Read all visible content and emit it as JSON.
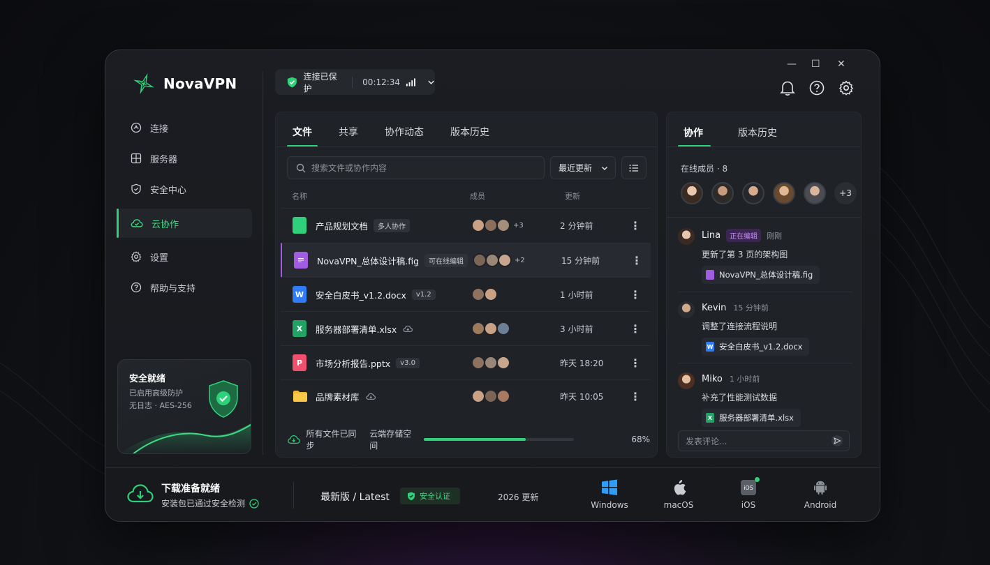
{
  "app": {
    "name": "NovaVPN"
  },
  "sidebar": {
    "items": [
      {
        "label": "连接",
        "icon": "connect-icon"
      },
      {
        "label": "服务器",
        "icon": "server-icon"
      },
      {
        "label": "安全中心",
        "icon": "shield-icon"
      },
      {
        "label": "云协作",
        "icon": "cloud-icon",
        "active": true
      },
      {
        "label": "设置",
        "icon": "gear-icon"
      },
      {
        "label": "帮助与支持",
        "icon": "help-icon"
      }
    ],
    "security_card": {
      "title": "安全就绪",
      "line1": "已启用高级防护",
      "line2": "无日志 · AES-256"
    }
  },
  "status": {
    "label": "连接已保护",
    "timer": "00:12:34"
  },
  "window_controls": {
    "minimize": "—",
    "maximize": "☐",
    "close": "✕"
  },
  "files_panel": {
    "tabs": [
      "文件",
      "共享",
      "协作动态",
      "版本历史"
    ],
    "active_tab": 0,
    "search_placeholder": "搜索文件或协作内容",
    "sort_label": "最近更新",
    "columns": {
      "name": "名称",
      "members": "成员",
      "updated": "更新"
    },
    "rows": [
      {
        "name": "产品规划文档",
        "tag": "多人协作",
        "type": "doc-green",
        "avatars": 3,
        "extra": "+3",
        "updated": "2 分钟前"
      },
      {
        "name": "NovaVPN_总体设计稿.fig",
        "tag": "可在线编辑",
        "type": "fig",
        "avatars": 3,
        "extra": "+2",
        "updated": "15 分钟前",
        "highlight": true
      },
      {
        "name": "安全白皮书_v1.2.docx",
        "tag": "v1.2",
        "type": "word",
        "avatars": 2,
        "extra": "",
        "updated": "1 小时前"
      },
      {
        "name": "服务器部署清单.xlsx",
        "tag": "",
        "cloud": true,
        "type": "excel",
        "avatars": 3,
        "extra": "",
        "updated": "3 小时前"
      },
      {
        "name": "市场分析报告.pptx",
        "tag": "v3.0",
        "type": "ppt",
        "avatars": 3,
        "extra": "",
        "updated": "昨天 18:20"
      },
      {
        "name": "品牌素材库",
        "tag": "",
        "cloud": true,
        "type": "folder",
        "avatars": 3,
        "extra": "",
        "updated": "昨天 10:05"
      }
    ],
    "footer": {
      "synced": "所有文件已同步",
      "storage_label": "云端存储空间",
      "storage_percent": "68%",
      "storage_fraction": 0.68
    }
  },
  "collab_panel": {
    "tabs": [
      "协作",
      "版本历史"
    ],
    "online_label": "在线成员 · 8",
    "online_extra": "+3",
    "activities": [
      {
        "name": "Lina",
        "badge": "正在编辑",
        "time": "刚刚",
        "text": "更新了第 3 页的架构图",
        "file": "NovaVPN_总体设计稿.fig",
        "file_type": "fig"
      },
      {
        "name": "Kevin",
        "badge": "",
        "time": "15 分钟前",
        "text": "调整了连接流程说明",
        "file": "安全白皮书_v1.2.docx",
        "file_type": "word"
      },
      {
        "name": "Miko",
        "badge": "",
        "time": "1 小时前",
        "text": "补充了性能测试数据",
        "file": "服务器部署清单.xlsx",
        "file_type": "excel"
      }
    ],
    "comment_placeholder": "发表评论..."
  },
  "bottom_bar": {
    "title": "下载准备就绪",
    "subtitle": "安装包已通过安全检测",
    "latest": "最新版 / Latest",
    "security_badge": "安全认证",
    "year": "2026 更新",
    "platforms": [
      "Windows",
      "macOS",
      "iOS",
      "Android"
    ]
  },
  "colors": {
    "accent": "#2fd07a",
    "purple": "#a25ce0",
    "bg": "#17191d"
  }
}
